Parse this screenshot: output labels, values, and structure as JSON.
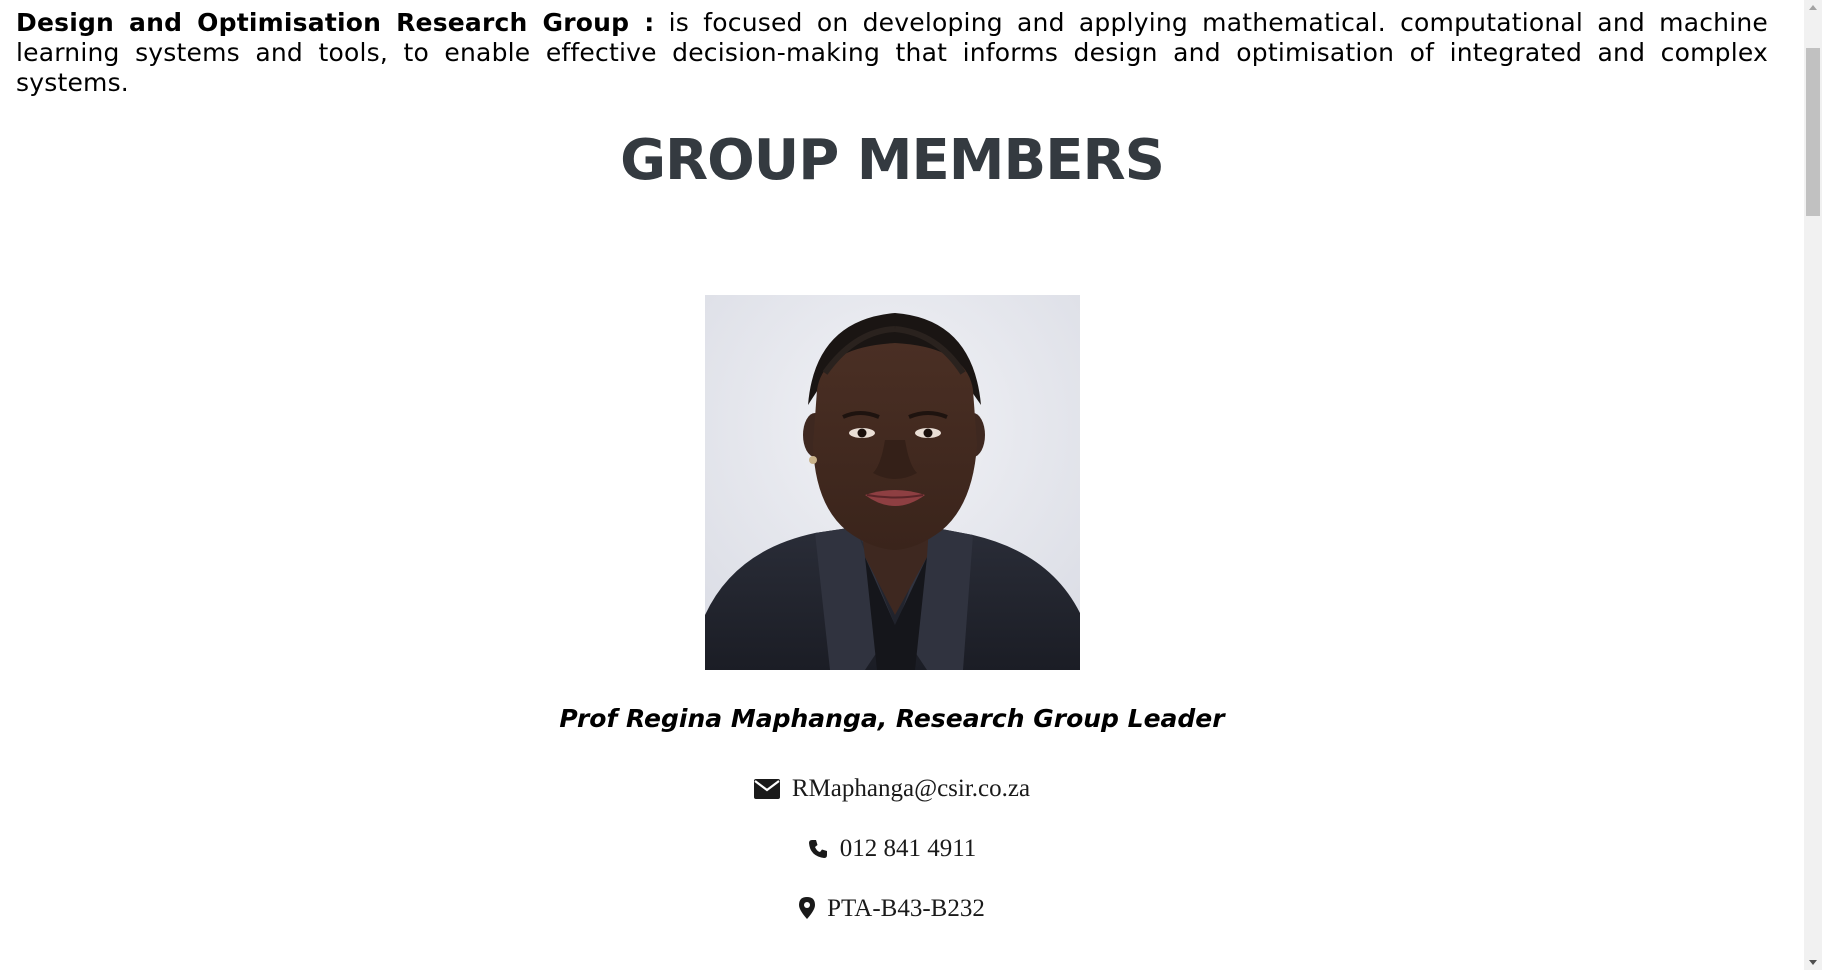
{
  "intro": {
    "org_name": "Design and Optimisation Research Group :",
    "description": " is focused on developing and applying mathematical. computational and machine learning systems and tools, to enable effective decision-making that informs design and optimisation of integrated and complex systems."
  },
  "members_section": {
    "title": "GROUP MEMBERS"
  },
  "member": {
    "name_title": "Prof Regina Maphanga, Research Group Leader",
    "email": "RMaphanga@csir.co.za",
    "phone": "012 841 4911",
    "office": "PTA-B43-B232"
  },
  "icons": {
    "email": "envelope-icon",
    "phone": "phone-icon",
    "office": "map-marker-icon"
  },
  "colors": {
    "heading": "#343a40",
    "text": "#000000",
    "page_bg": "#ffffff"
  }
}
